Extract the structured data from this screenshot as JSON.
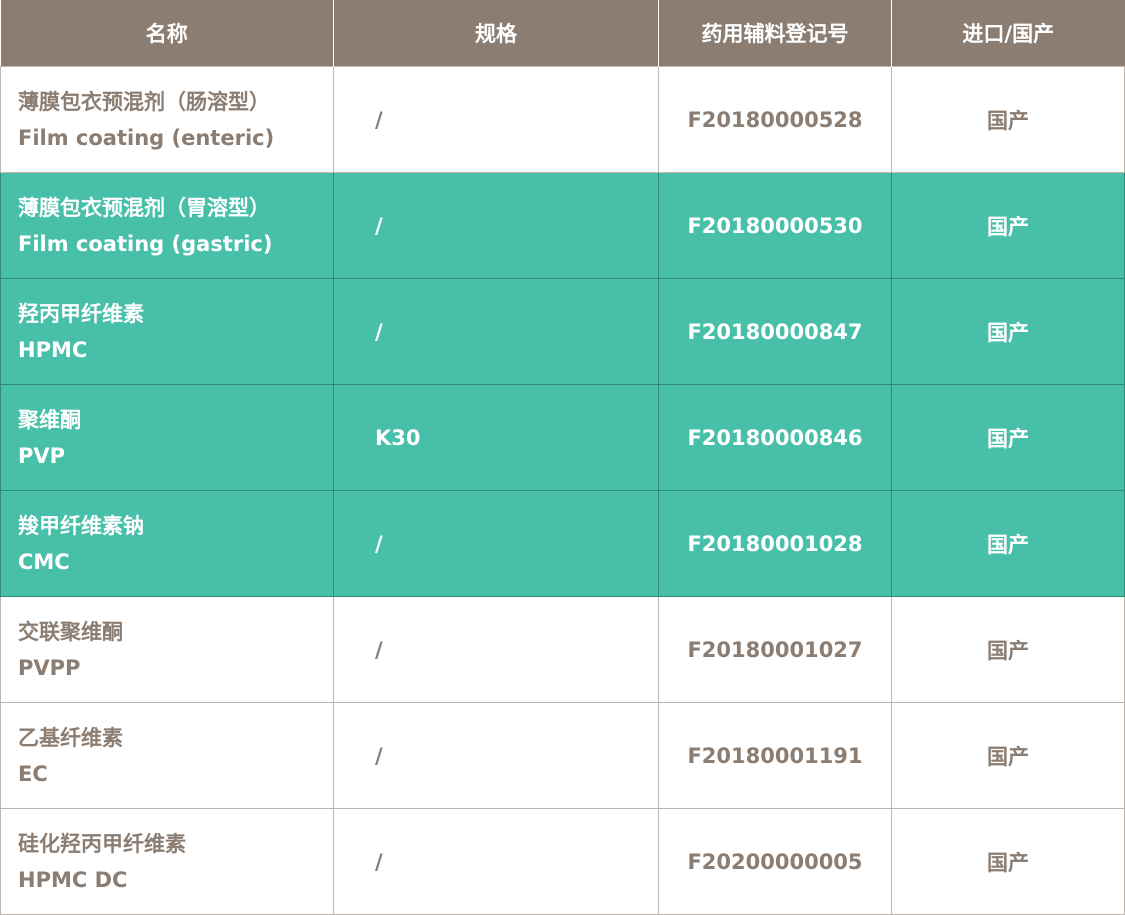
{
  "table": {
    "headers": [
      "名称",
      "规格",
      "药用辅料登记号",
      "进口/国产"
    ],
    "rows": [
      {
        "name_cn": "薄膜包衣预混剂（肠溶型）",
        "name_en": "Film coating (enteric)",
        "spec": "/",
        "code": "F20180000528",
        "origin": "国产"
      },
      {
        "name_cn": "薄膜包衣预混剂（胃溶型）",
        "name_en": "Film coating (gastric)",
        "spec": "/",
        "code": "F20180000530",
        "origin": "国产"
      },
      {
        "name_cn": "羟丙甲纤维素",
        "name_en": "HPMC",
        "spec": "/",
        "code": "F20180000847",
        "origin": "国产"
      },
      {
        "name_cn": "聚维酮",
        "name_en": "PVP",
        "spec": "K30",
        "code": "F20180000846",
        "origin": "国产"
      },
      {
        "name_cn": "羧甲纤维素钠",
        "name_en": "CMC",
        "spec": "/",
        "code": "F20180001028",
        "origin": "国产"
      },
      {
        "name_cn": "交联聚维酮",
        "name_en": "PVPP",
        "spec": "/",
        "code": "F20180001027",
        "origin": "国产"
      },
      {
        "name_cn": "乙基纤维素",
        "name_en": "EC",
        "spec": "/",
        "code": "F20180001191",
        "origin": "国产"
      },
      {
        "name_cn": "硅化羟丙甲纤维素",
        "name_en": "HPMC DC",
        "spec": "/",
        "code": "F20200000005",
        "origin": "国产"
      }
    ]
  },
  "colors": {
    "header_bg": "#8b7d72",
    "header_text": "#ffffff",
    "body_text": "#8b7d72",
    "highlight_bg": "#48bfa9",
    "highlight_text": "#ffffff",
    "border": "#bdb6b0"
  }
}
